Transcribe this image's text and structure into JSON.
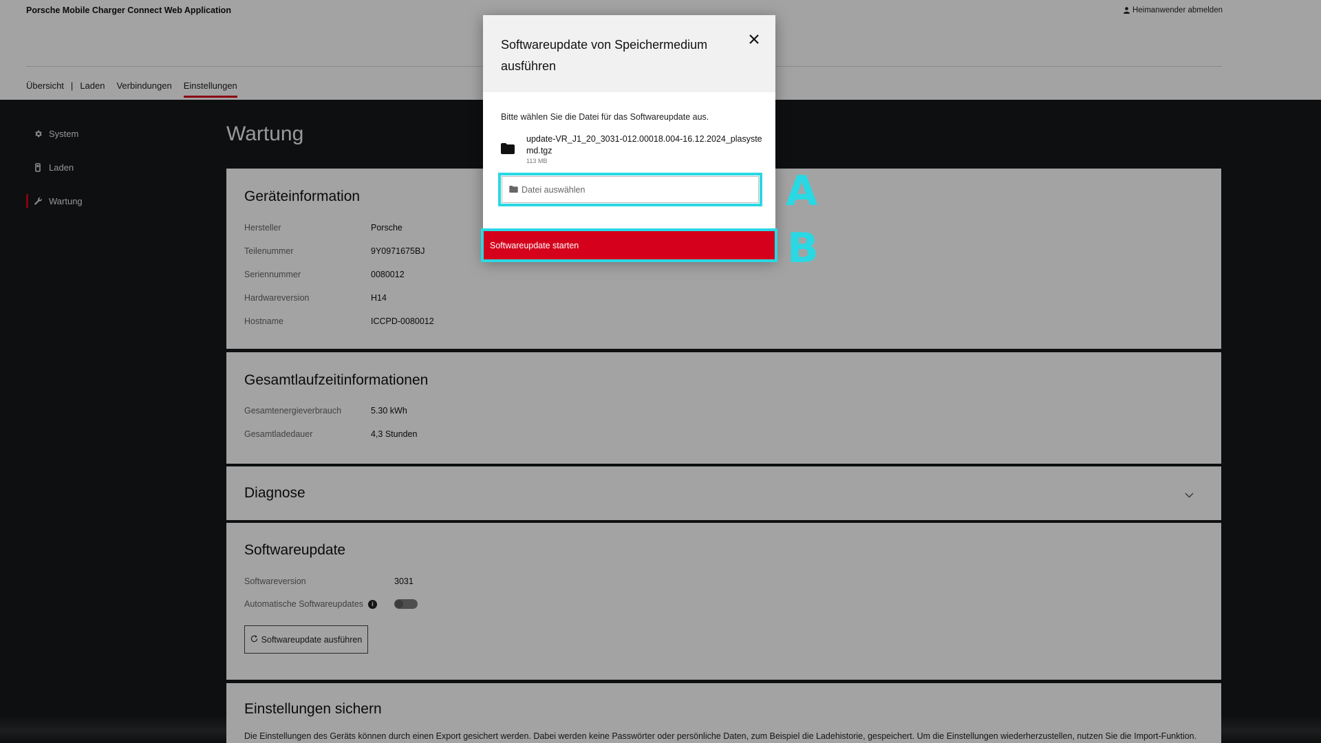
{
  "app": {
    "title": "Porsche Mobile Charger Connect Web Application",
    "logout_label": "Heimanwender abmelden"
  },
  "nav": {
    "items": [
      "Übersicht",
      "Laden",
      "Verbindungen",
      "Einstellungen"
    ],
    "separator": "|",
    "active": "Einstellungen"
  },
  "sidebar": {
    "items": [
      {
        "label": "System",
        "icon": "gear-icon"
      },
      {
        "label": "Laden",
        "icon": "charger-icon"
      },
      {
        "label": "Wartung",
        "icon": "wrench-icon",
        "active": true
      }
    ]
  },
  "page": {
    "title": "Wartung"
  },
  "device_info": {
    "title": "Geräteinformation",
    "rows": [
      {
        "label": "Hersteller",
        "value": "Porsche"
      },
      {
        "label": "Teilenummer",
        "value": "9Y0971675BJ"
      },
      {
        "label": "Seriennummer",
        "value": "0080012"
      },
      {
        "label": "Hardwareversion",
        "value": "H14"
      },
      {
        "label": "Hostname",
        "value": "ICCPD-0080012"
      }
    ]
  },
  "runtime": {
    "title": "Gesamtlaufzeitinformationen",
    "rows": [
      {
        "label": "Gesamtenergieverbrauch",
        "value": "5.30 kWh"
      },
      {
        "label": "Gesamtladedauer",
        "value": "4,3 Stunden"
      }
    ]
  },
  "diagnose": {
    "title": "Diagnose",
    "expanded": false
  },
  "software": {
    "title": "Softwareupdate",
    "version_label": "Softwareversion",
    "version_value": "3031",
    "auto_label": "Automatische Softwareupdates",
    "auto_enabled": false,
    "run_button": "Softwareupdate ausführen"
  },
  "backup": {
    "title": "Einstellungen sichern",
    "text": "Die Einstellungen des Geräts können durch einen Export gesichert werden. Dabei werden keine Passwörter oder persönliche Daten, zum Beispiel die Ladehistorie, gespeichert. Um die Einstellungen wiederherzustellen, nutzen Sie die Import-Funktion."
  },
  "modal": {
    "title": "Softwareupdate von Speichermedium ausführen",
    "description": "Bitte wählen Sie die Datei für das Softwareupdate aus.",
    "file_name": "update-VR_J1_20_3031-012.00018.004-16.12.2024_plasystemd.tgz",
    "file_size": "113 MB",
    "file_input_label": "Datei auswählen",
    "start_button": "Softwareupdate starten"
  },
  "annotations": {
    "marker_a": "A",
    "marker_b": "B",
    "highlight_color": "#2ad8e3"
  },
  "colors": {
    "accent": "#d5001c",
    "dark_bg": "#15181a"
  }
}
